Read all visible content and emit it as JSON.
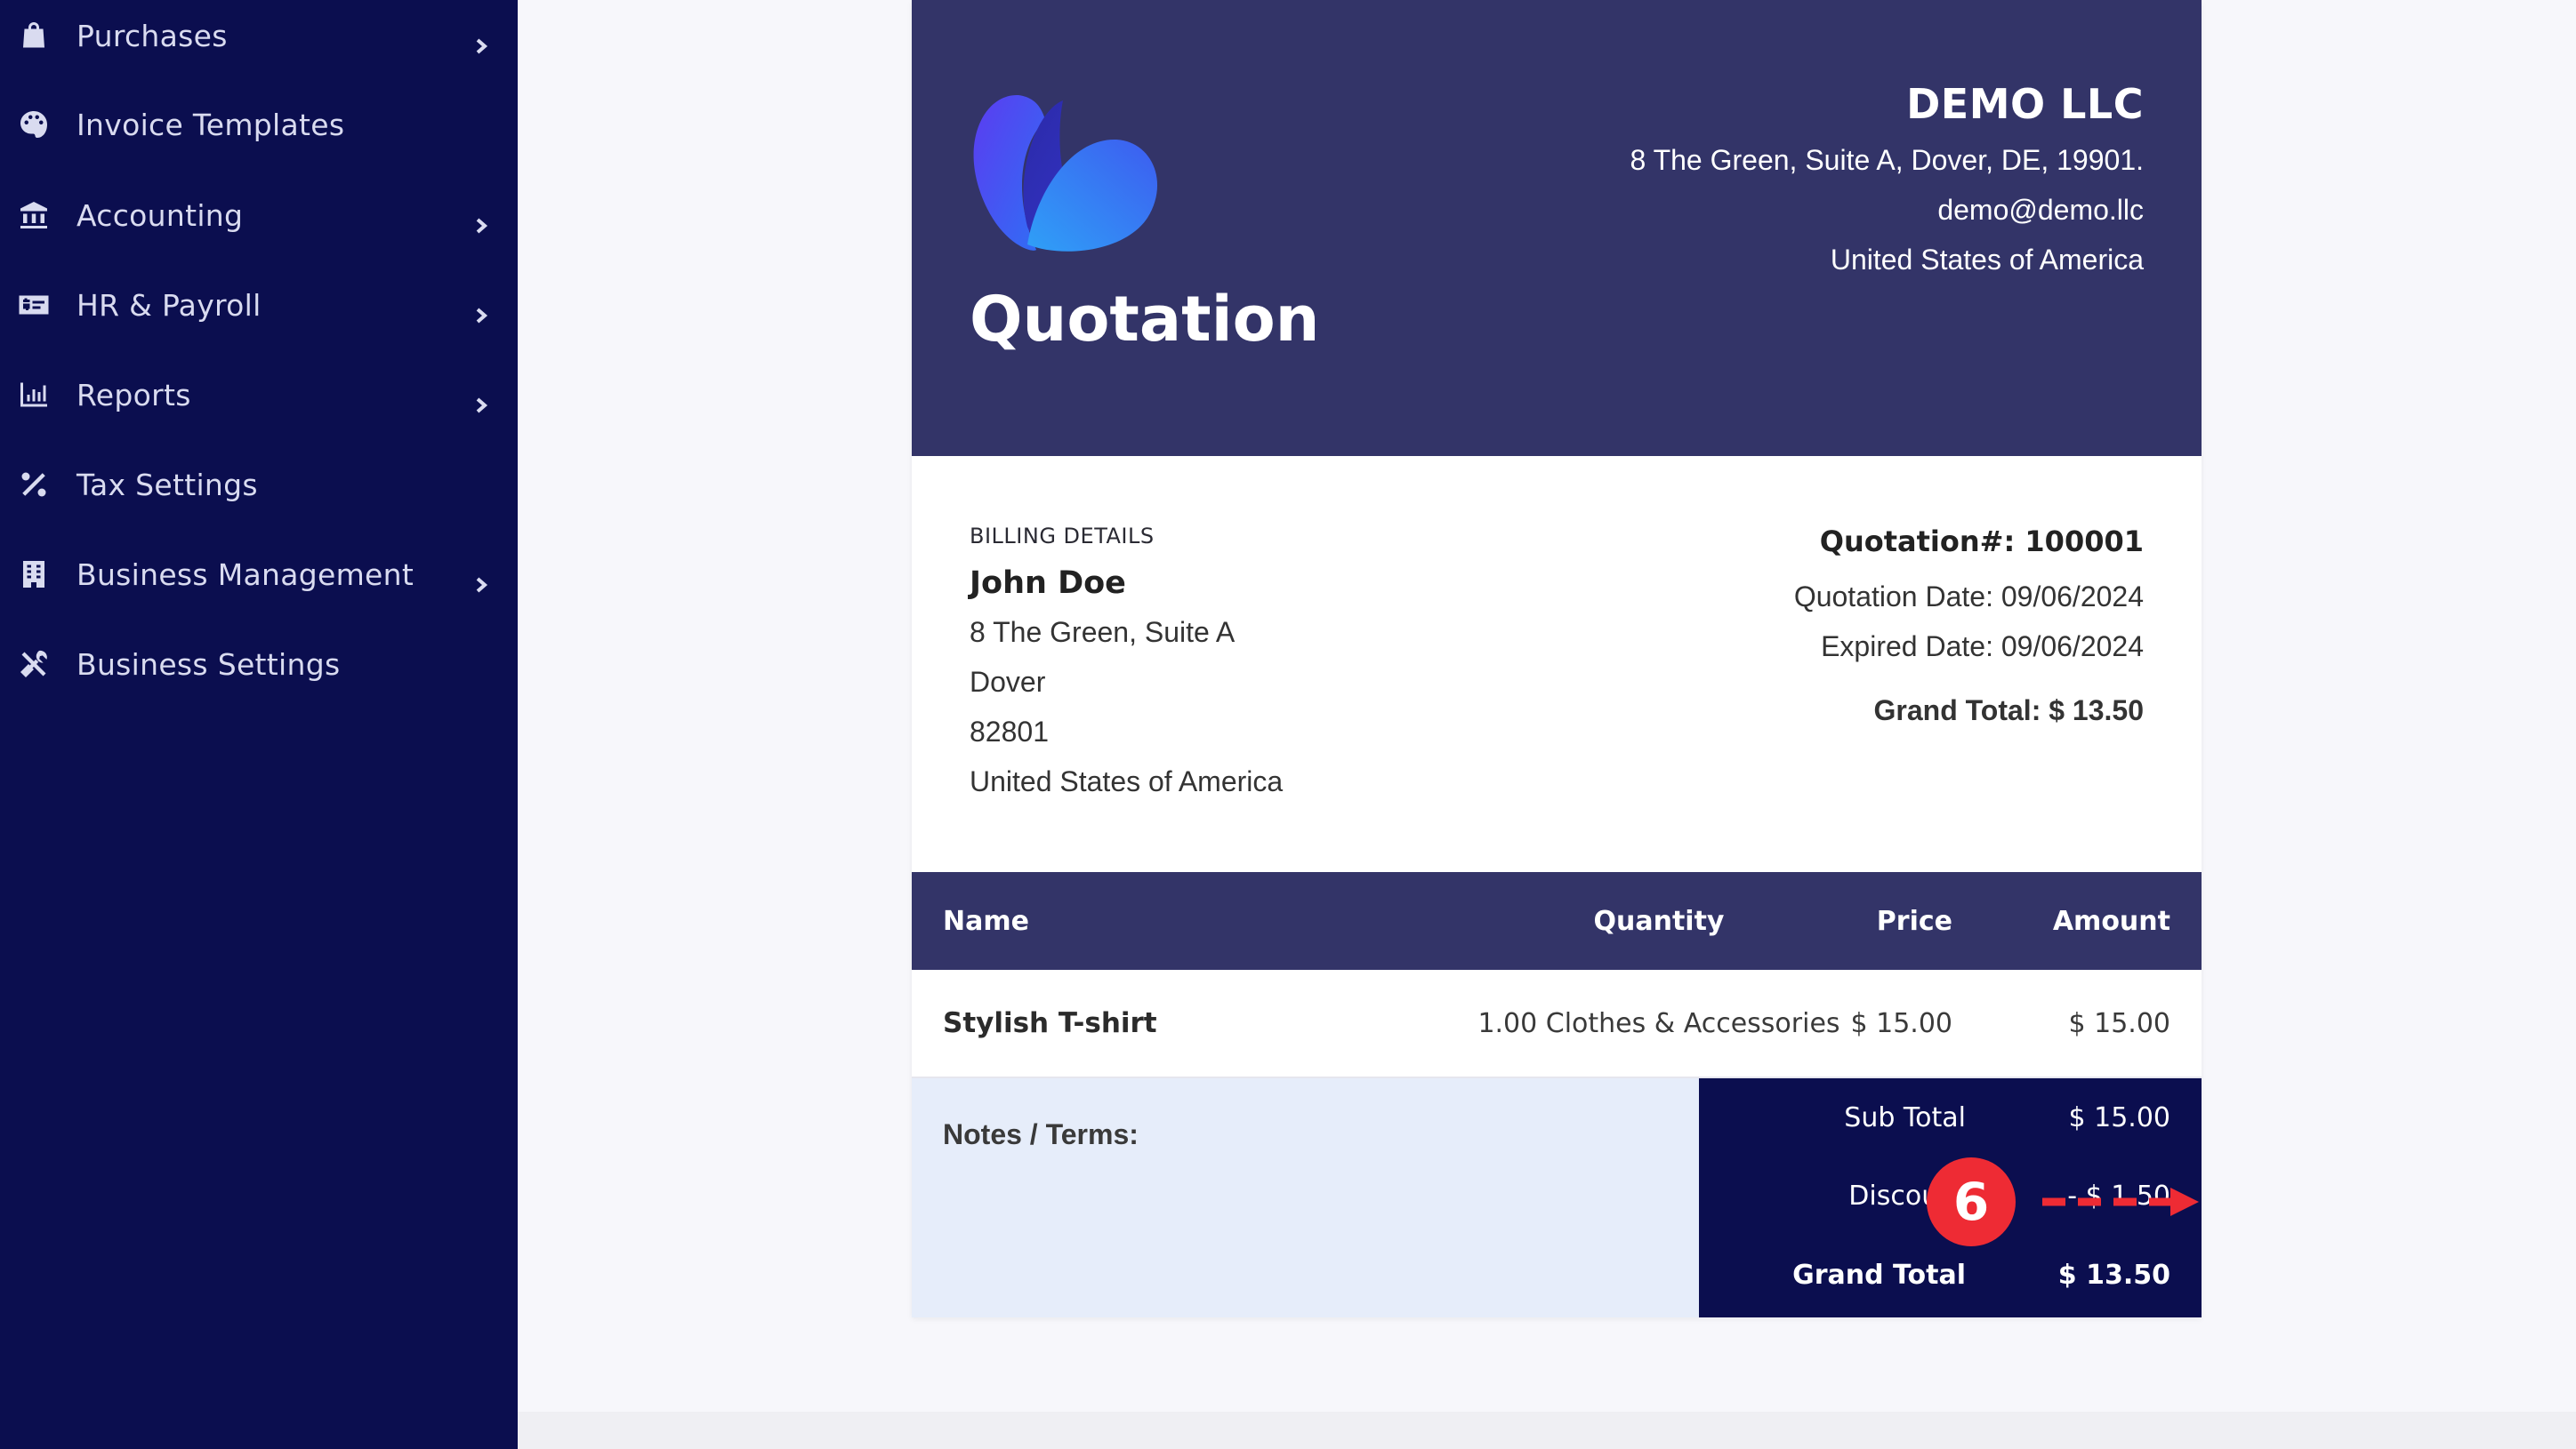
{
  "sidebar": {
    "items": [
      {
        "label": "Purchases",
        "icon": "shopping-bag-icon",
        "has_submenu": true
      },
      {
        "label": "Invoice Templates",
        "icon": "palette-icon",
        "has_submenu": false
      },
      {
        "label": "Accounting",
        "icon": "bank-icon",
        "has_submenu": true
      },
      {
        "label": "HR & Payroll",
        "icon": "money-check-icon",
        "has_submenu": true
      },
      {
        "label": "Reports",
        "icon": "bar-chart-icon",
        "has_submenu": true
      },
      {
        "label": "Tax Settings",
        "icon": "percent-icon",
        "has_submenu": false
      },
      {
        "label": "Business Management",
        "icon": "building-icon",
        "has_submenu": true
      },
      {
        "label": "Business Settings",
        "icon": "tools-icon",
        "has_submenu": false
      }
    ]
  },
  "document": {
    "title": "Quotation",
    "company": {
      "name": "DEMO LLC",
      "address": "8 The Green, Suite A, Dover, DE, 19901.",
      "email": "demo@demo.llc",
      "country": "United States of America"
    },
    "billing": {
      "heading": "BILLING DETAILS",
      "name": "John Doe",
      "address_line": "8 The Green, Suite A",
      "city": "Dover",
      "zip": "82801",
      "country": "United States of America"
    },
    "meta": {
      "number": "Quotation#: 100001",
      "date": "Quotation Date: 09/06/2024",
      "expired": "Expired Date: 09/06/2024",
      "grand_total": "Grand Total: $ 13.50"
    },
    "table": {
      "headers": {
        "name": "Name",
        "quantity": "Quantity",
        "price": "Price",
        "amount": "Amount"
      },
      "rows": [
        {
          "name": "Stylish T-shirt",
          "quantity": "1.00 Clothes & Accessories",
          "price": "$ 15.00",
          "amount": "$ 15.00"
        }
      ]
    },
    "notes_label": "Notes / Terms:",
    "totals": {
      "sub_total_label": "Sub Total",
      "sub_total": "$ 15.00",
      "discount_label": "Discount",
      "discount": "- $ 1.50",
      "grand_total_label": "Grand Total",
      "grand_total": "$ 13.50"
    }
  },
  "annotation": {
    "step": "6"
  },
  "colors": {
    "sidebar_bg": "#0b0e4f",
    "header_bg": "#333468",
    "notes_bg": "#e6edfa",
    "badge": "#ee2b34"
  }
}
